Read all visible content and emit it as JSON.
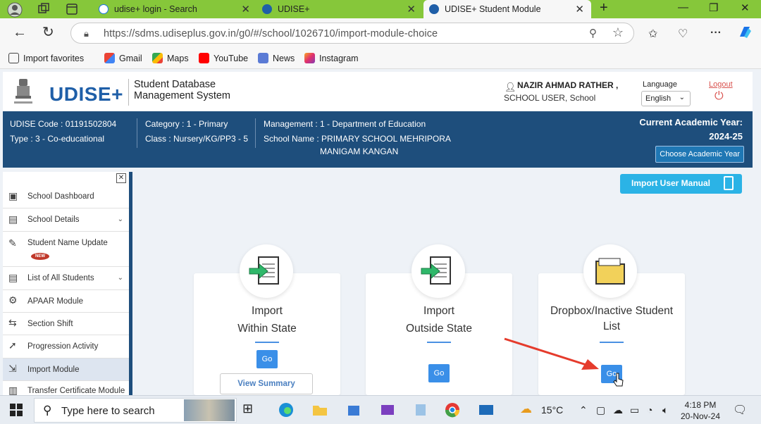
{
  "browser": {
    "tabs": [
      {
        "title": "udise+ login - Search"
      },
      {
        "title": "UDISE+"
      },
      {
        "title": "UDISE+ Student Module"
      }
    ],
    "url": "https://sdms.udiseplus.gov.in/g0/#/school/1026710/import-module-choice",
    "bookmarks": [
      "Import favorites",
      "Gmail",
      "Maps",
      "YouTube",
      "News",
      "Instagram"
    ]
  },
  "header": {
    "logo": "UDISE+",
    "system_name_line1": "Student Database",
    "system_name_line2": "Management System",
    "user_name": "NAZIR AHMAD RATHER ,",
    "user_role": "SCHOOL USER,   School",
    "language_label": "Language",
    "language_value": "English",
    "logout": "Logout"
  },
  "school_info": {
    "udise_code": "UDISE Code : 01191502804",
    "type": "Type : 3 - Co-educational",
    "category": "Category : 1 - Primary",
    "class": "Class : Nursery/KG/PP3 - 5",
    "management": "Management : 1 - Department of Education",
    "school_name_label": "School Name :",
    "school_name_line1": "PRIMARY SCHOOL MEHRIPORA",
    "school_name_line2": "MANIGAM KANGAN",
    "academic_year_label": "Current Academic Year:",
    "academic_year": "2024-25",
    "choose_year_button": "Choose Academic Year"
  },
  "sidebar": {
    "items": [
      {
        "label": "School Dashboard",
        "icon": "dashboard-icon"
      },
      {
        "label": "School Details",
        "icon": "details-icon"
      },
      {
        "label": "Student Name Update",
        "icon": "user-edit-icon",
        "badge": "NEW"
      },
      {
        "label": "List of All Students",
        "icon": "list-icon"
      },
      {
        "label": "APAAR Module",
        "icon": "gear-icon"
      },
      {
        "label": "Section Shift",
        "icon": "shift-icon"
      },
      {
        "label": "Progression Activity",
        "icon": "progression-icon"
      },
      {
        "label": "Import Module",
        "icon": "import-icon"
      },
      {
        "label": "Transfer Certificate Module",
        "icon": "certificate-icon"
      }
    ]
  },
  "main": {
    "manual_button": "Import User Manual",
    "cards": [
      {
        "title_line1": "Import",
        "title_line2": "Within State",
        "go": "Go",
        "summary": "View Summary"
      },
      {
        "title_line1": "Import",
        "title_line2": "Outside State",
        "go": "Go"
      },
      {
        "title_line1": "Dropbox/Inactive Student",
        "title_line2": "List",
        "go": "Go"
      }
    ]
  },
  "taskbar": {
    "search_placeholder": "Type here to search",
    "temperature": "15°C",
    "time": "4:18 PM",
    "date": "20-Nov-24"
  },
  "colors": {
    "tab_strip": "#86c73a",
    "info_bar": "#1e4e7c",
    "manual_button": "#2bb3e6",
    "go_button": "#3a8fe8",
    "annotation_arrow": "#e53b2c"
  }
}
